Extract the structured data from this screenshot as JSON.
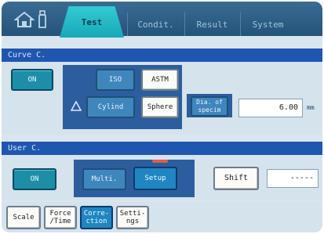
{
  "tabs": {
    "home_icons": [
      "home-icon",
      "bottle-icon"
    ],
    "items": [
      {
        "label": "Test",
        "active": true
      },
      {
        "label": "Condit.",
        "active": false
      },
      {
        "label": "Result",
        "active": false
      },
      {
        "label": "System",
        "active": false
      }
    ]
  },
  "curve_section": {
    "title": "Curve C.",
    "on_label": "ON",
    "iso_label": "ISO",
    "astm_label": "ASTM",
    "cylind_label": "Cylind",
    "sphere_label": "Sphere",
    "dia_label": "Dia. of specim",
    "dia_value": "6.00",
    "dia_unit": "mm"
  },
  "user_section": {
    "title": "User C.",
    "on_label": "ON",
    "multi_label": "Multi.",
    "setup_label": "Setup",
    "shift_label": "Shift",
    "shift_value": "-----"
  },
  "bottom": {
    "scale_label": "Scale",
    "force_time_label": "Force /Time",
    "correction_label": "Corre- ction",
    "setting_label": "Setti- ngs"
  },
  "colors": {
    "tab_active": "#1aaebe",
    "section_header": "#1f56b0",
    "button_teal": "#1e8ea7"
  }
}
